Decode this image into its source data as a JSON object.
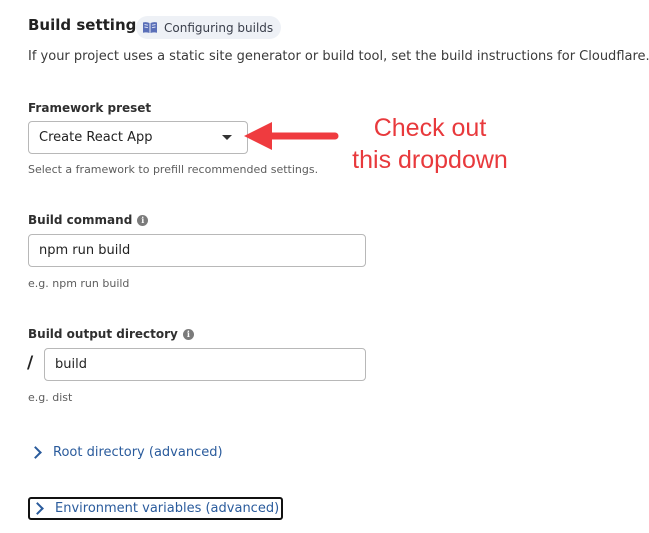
{
  "header": {
    "title": "Build settings",
    "doc_chip_label": "Configuring builds",
    "intro": "If your project uses a static site generator or build tool, set the build instructions for Cloudflare."
  },
  "framework": {
    "label": "Framework preset",
    "value": "Create React App",
    "hint": "Select a framework to prefill recommended settings."
  },
  "build_command": {
    "label": "Build command",
    "value": "npm run build",
    "hint": "e.g. npm run build"
  },
  "output_dir": {
    "label": "Build output directory",
    "prefix": "/",
    "value": "build",
    "hint": "e.g. dist"
  },
  "advanced": {
    "root_directory": "Root directory (advanced)",
    "env_vars": "Environment variables (advanced)"
  },
  "annotation": {
    "line1": "Check out",
    "line2": "this dropdown",
    "color": "#e8393c"
  },
  "colors": {
    "link": "#2a5b9c",
    "chip_bg": "#eef1f6"
  },
  "icons": {
    "doc": "book-icon",
    "info": "info-icon",
    "dropdown": "caret-down-icon",
    "expand": "chevron-right-icon",
    "annotation_arrow": "arrow-left-icon"
  }
}
